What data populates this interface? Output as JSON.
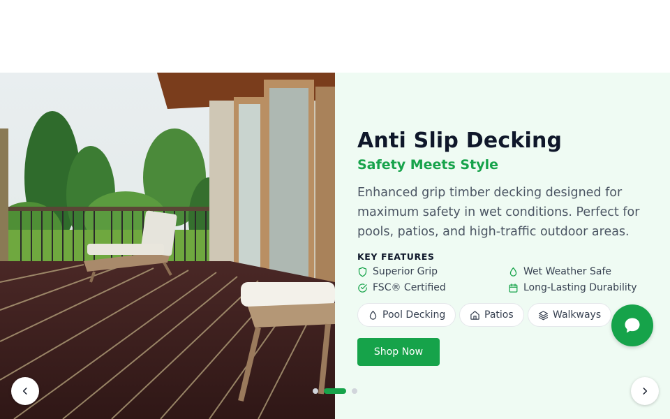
{
  "hero": {
    "title": "Anti Slip Decking",
    "subtitle": "Safety Meets Style",
    "description": "Enhanced grip timber decking designed for maximum safety in wet conditions. Perfect for pools, patios, and high-traffic outdoor areas.",
    "key_features_heading": "KEY FEATURES",
    "features": [
      {
        "label": "Superior Grip",
        "icon": "shield-icon"
      },
      {
        "label": "Wet Weather Safe",
        "icon": "droplet-icon"
      },
      {
        "label": "FSC® Certified",
        "icon": "check-circle-icon"
      },
      {
        "label": "Long-Lasting Durability",
        "icon": "calendar-icon"
      }
    ],
    "applications": [
      {
        "label": "Pool Decking",
        "icon": "droplet-icon"
      },
      {
        "label": "Patios",
        "icon": "home-icon"
      },
      {
        "label": "Walkways",
        "icon": "layers-icon"
      }
    ],
    "cta_label": "Shop Now"
  },
  "carousel": {
    "slide_count": 3,
    "active_index": 1,
    "prev_icon": "chevron-left-icon",
    "next_icon": "chevron-right-icon"
  },
  "chat": {
    "icon": "chat-bubble-icon"
  },
  "colors": {
    "accent": "#16a34a",
    "panel_background": "#effbf3",
    "title": "#0f172a",
    "body_text": "#4b5563"
  }
}
